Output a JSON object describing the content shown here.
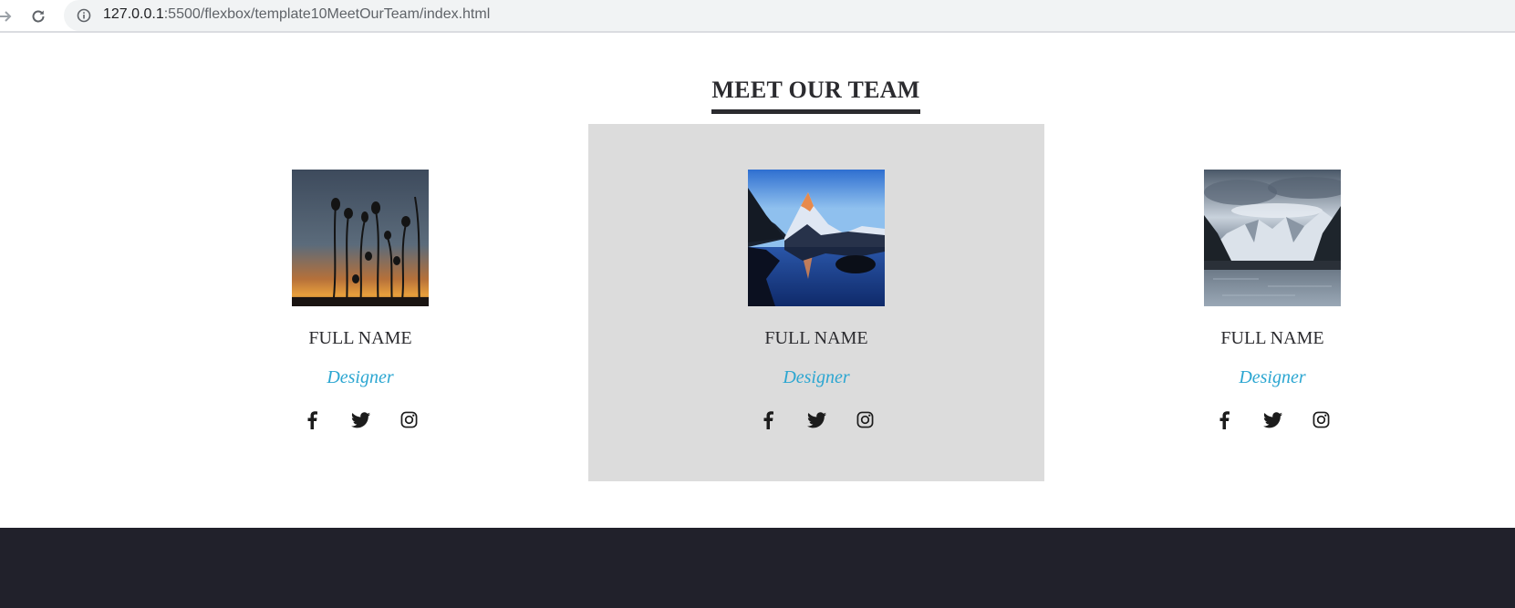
{
  "browser": {
    "url_host": "127.0.0.1",
    "url_rest": ":5500/flexbox/template10MeetOurTeam/index.html",
    "icons": [
      "forward-icon",
      "reload-icon",
      "site-info-icon"
    ]
  },
  "section": {
    "title": "MEET OUR TEAM"
  },
  "members": [
    {
      "name": "FULL NAME",
      "role": "Designer",
      "photo": "silhouette-flowers-sunset",
      "highlighted": false
    },
    {
      "name": "FULL NAME",
      "role": "Designer",
      "photo": "mountain-lake-reflection",
      "highlighted": true
    },
    {
      "name": "FULL NAME",
      "role": "Designer",
      "photo": "snowy-mountains-frozen-lake",
      "highlighted": false
    }
  ],
  "social_icons": [
    "facebook-icon",
    "twitter-icon",
    "instagram-icon"
  ],
  "colors": {
    "accent": "#2ba6d1",
    "text": "#2b2b2f",
    "card_highlight": "#dcdcdc",
    "footer": "#21212b"
  }
}
